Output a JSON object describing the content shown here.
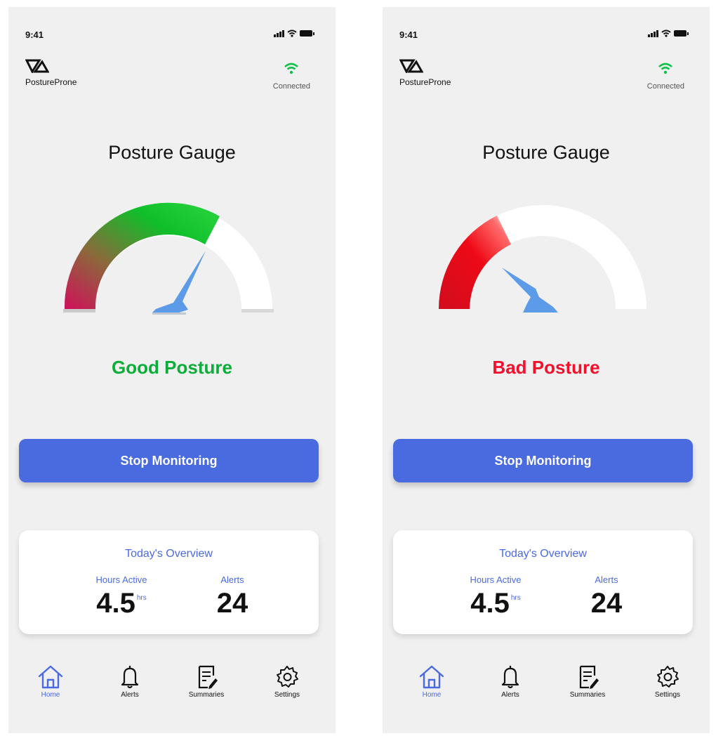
{
  "screens": [
    {
      "status_time": "9:41",
      "brand": "PostureProne",
      "connection": "Connected",
      "gauge_title": "Posture Gauge",
      "gauge_level": 0.72,
      "posture_status": "Good Posture",
      "status_color": "#0aae38",
      "button_label": "Stop Monitoring",
      "overview": {
        "title": "Today's Overview",
        "hours_label": "Hours Active",
        "hours_value": "4.5",
        "hours_unit": "hrs",
        "alerts_label": "Alerts",
        "alerts_value": "24"
      },
      "nav": [
        {
          "label": "Home",
          "icon": "home-icon"
        },
        {
          "label": "Alerts",
          "icon": "bell-icon"
        },
        {
          "label": "Summaries",
          "icon": "document-edit-icon"
        },
        {
          "label": "Settings",
          "icon": "gear-icon"
        }
      ]
    },
    {
      "status_time": "9:41",
      "brand": "PostureProne",
      "connection": "Connected",
      "gauge_title": "Posture Gauge",
      "gauge_level": 0.28,
      "posture_status": "Bad Posture",
      "status_color": "#f2102a",
      "button_label": "Stop Monitoring",
      "overview": {
        "title": "Today's Overview",
        "hours_label": "Hours Active",
        "hours_value": "4.5",
        "hours_unit": "hrs",
        "alerts_label": "Alerts",
        "alerts_value": "24"
      },
      "nav": [
        {
          "label": "Home",
          "icon": "home-icon"
        },
        {
          "label": "Alerts",
          "icon": "bell-icon"
        },
        {
          "label": "Summaries",
          "icon": "document-edit-icon"
        },
        {
          "label": "Settings",
          "icon": "gear-icon"
        }
      ]
    }
  ],
  "colors": {
    "accent": "#4a6ae0",
    "needle": "#5b9be8",
    "good": "#0aae38",
    "bad": "#f2102a"
  }
}
